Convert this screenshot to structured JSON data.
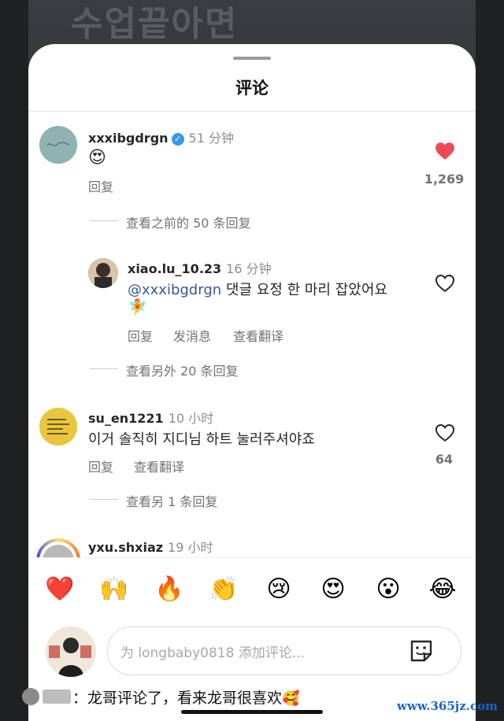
{
  "background": {
    "caption": "수업끝아면"
  },
  "sheet": {
    "title": "评论"
  },
  "comments": [
    {
      "username": "xxxibgdrgn",
      "verified": true,
      "time": "51 分钟",
      "text": "😍",
      "actions": [
        "回复"
      ],
      "likes": "1,269",
      "liked": true
    },
    {
      "thread": "查看之前的 50 条回复",
      "username": "xiao.lu_10.23",
      "time": "16 分钟",
      "mention": "@xxxibgdrgn",
      "text": "댓글 요정 한 마리 잡았어요",
      "text2": "🧚",
      "actions": [
        "回复",
        "发消息",
        "查看翻译"
      ]
    },
    {
      "thread": "查看另外 20 条回复",
      "username": "su_en1221",
      "time": "10 小时",
      "text": "이거 솔직히 지디님 하트 눌러주셔야죠",
      "actions": [
        "回复",
        "查看翻译"
      ],
      "likes": "64"
    },
    {
      "thread": "查看另 1 条回复",
      "username": "yxu.shxiaz",
      "time": "19 小时"
    }
  ],
  "emoji_bar": [
    "❤️",
    "🙌",
    "🔥",
    "👏",
    "😢",
    "😍",
    "😮",
    "😂"
  ],
  "input": {
    "placeholder": "为 longbaby0818 添加评论..."
  },
  "caption": {
    "text": "：龙哥评论了，看来龙哥很喜欢",
    "emoji": "🥰",
    "name_fragment": "斋"
  },
  "watermark": "www.365jz.com",
  "colors": {
    "like": "#ed4956",
    "verified": "#3897f0",
    "mention": "#385898"
  }
}
